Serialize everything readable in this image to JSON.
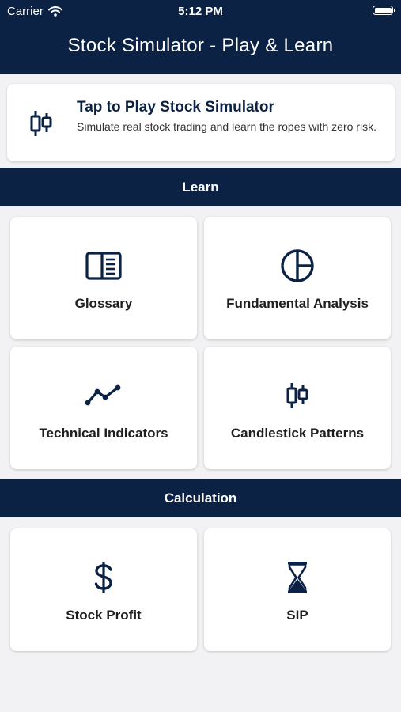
{
  "status_bar": {
    "carrier": "Carrier",
    "time": "5:12 PM"
  },
  "header": {
    "title": "Stock Simulator - Play & Learn"
  },
  "simulator_card": {
    "title": "Tap to Play Stock Simulator",
    "description": "Simulate real stock trading and learn the ropes with zero risk.",
    "icon": "candlestick-icon"
  },
  "learn_section": {
    "heading": "Learn",
    "tiles": [
      {
        "label": "Glossary",
        "icon": "book-icon"
      },
      {
        "label": "Fundamental Analysis",
        "icon": "pie-chart-icon"
      },
      {
        "label": "Technical Indicators",
        "icon": "line-chart-icon"
      },
      {
        "label": "Candlestick Patterns",
        "icon": "candlestick-icon"
      }
    ]
  },
  "calculation_section": {
    "heading": "Calculation",
    "tiles": [
      {
        "label": "Stock Profit",
        "icon": "dollar-icon"
      },
      {
        "label": "SIP",
        "icon": "hourglass-icon"
      }
    ]
  },
  "colors": {
    "primary": "#0b2245",
    "background": "#f2f2f4",
    "card": "#ffffff"
  }
}
